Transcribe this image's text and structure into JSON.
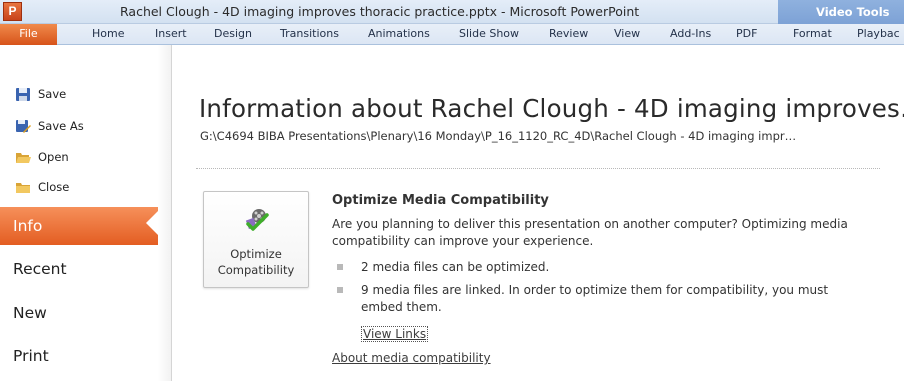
{
  "window": {
    "title": "Rachel Clough - 4D imaging improves thoracic practice.pptx - Microsoft PowerPoint",
    "app_letter": "P",
    "contextual_group": "Video Tools"
  },
  "ribbon": {
    "tabs": [
      "File",
      "Home",
      "Insert",
      "Design",
      "Transitions",
      "Animations",
      "Slide Show",
      "Review",
      "View",
      "Add-Ins",
      "PDF",
      "Format",
      "Playbac"
    ]
  },
  "backstage": {
    "commands": [
      {
        "label": "Save",
        "icon": "save-icon"
      },
      {
        "label": "Save As",
        "icon": "save-as-icon"
      },
      {
        "label": "Open",
        "icon": "open-folder-icon"
      },
      {
        "label": "Close",
        "icon": "close-folder-icon"
      }
    ],
    "nav": [
      "Info",
      "Recent",
      "New",
      "Print"
    ],
    "selected": "Info"
  },
  "info": {
    "title": "Information about Rachel Clough - 4D imaging improves…",
    "path": "G:\\C4694 BIBA Presentations\\Plenary\\16 Monday\\P_16_1120_RC_4D\\Rachel Clough - 4D imaging impr…",
    "optimize_button": {
      "line1": "Optimize",
      "line2": "Compatibility",
      "icon": "film-reel-checkmark-icon"
    },
    "section_title": "Optimize Media Compatibility",
    "section_desc": "Are you planning to deliver this presentation on another computer? Optimizing media compatibility can improve your experience.",
    "bullets": [
      "2 media files can be optimized.",
      "9 media files are linked. In order to optimize them for compatibility, you must embed them."
    ],
    "view_links": "View Links",
    "about_link": "About media compatibility"
  },
  "colors": {
    "accent_orange": "#e35d22",
    "ribbon_blue": "#dce6f4",
    "context_blue": "#6e95cf"
  }
}
